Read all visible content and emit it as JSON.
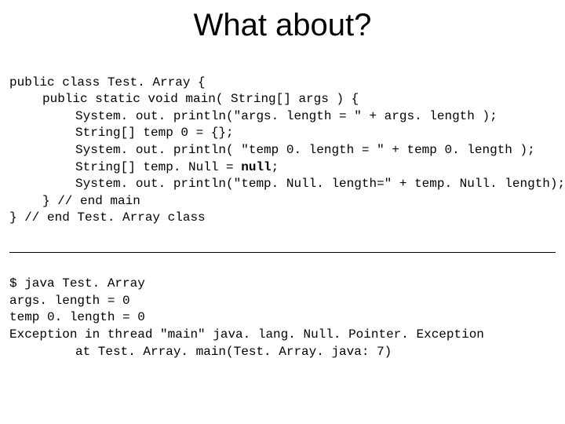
{
  "title": "What about?",
  "code": {
    "l1": "public class Test. Array {",
    "l2": "public static void main( String[] args ) {",
    "l3": "System. out. println(\"args. length = \" + args. length );",
    "l4": "String[] temp 0 = {};",
    "l5a": "System. out. println( \"temp 0. length = \" + temp 0. length );",
    "l6a": "String[] temp. Null = ",
    "l6b": "null",
    "l6c": ";",
    "l7": "System. out. println(\"temp. Null. length=\" + temp. Null. length);",
    "l8": "} // end main",
    "l9": "} // end Test. Array class"
  },
  "output": {
    "o1": "$ java Test. Array",
    "o2": "args. length = 0",
    "o3": "temp 0. length = 0",
    "o4": "Exception in thread \"main\" java. lang. Null. Pointer. Exception",
    "o5": "at Test. Array. main(Test. Array. java: 7)"
  }
}
